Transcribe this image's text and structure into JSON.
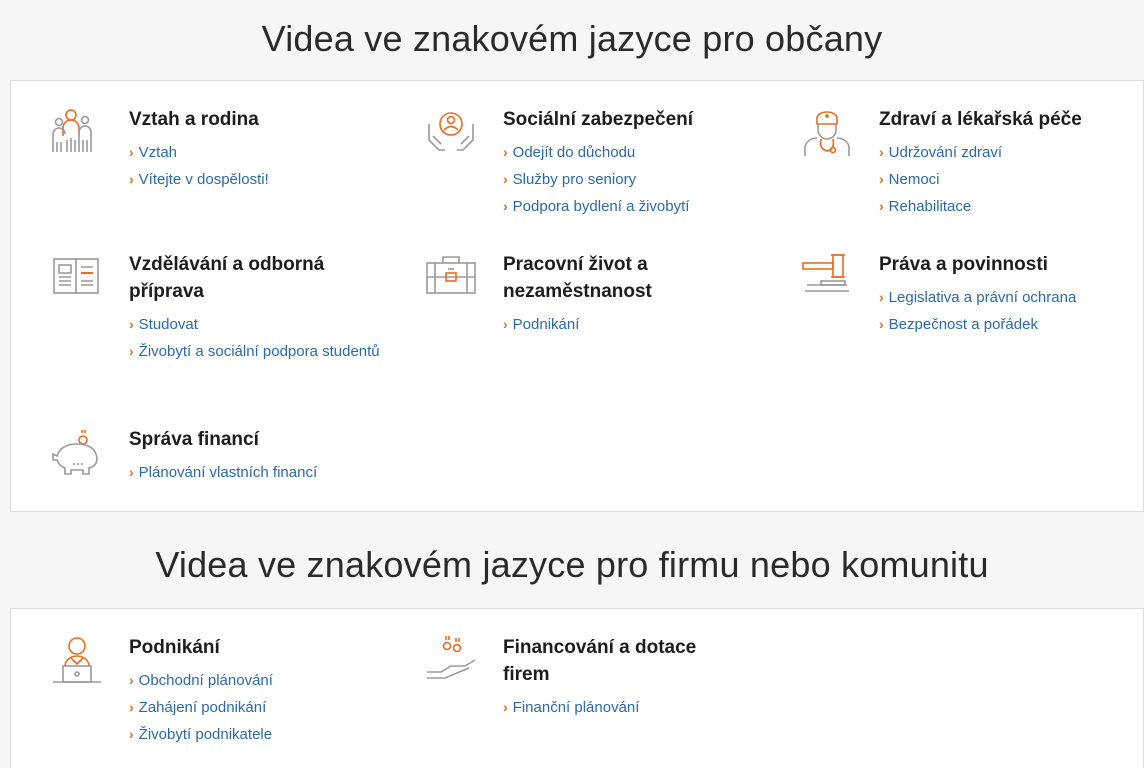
{
  "sections": [
    {
      "title": "Videa ve znakovém jazyce pro občany",
      "categories": [
        {
          "title": "Vztah a rodina",
          "icon": "family-icon",
          "links": [
            "Vztah",
            "Vítejte v dospělosti!"
          ]
        },
        {
          "title": "Sociální zabezpečení",
          "icon": "social-care-icon",
          "links": [
            "Odejít do důchodu",
            "Služby pro seniory",
            "Podpora bydlení a živobytí"
          ]
        },
        {
          "title": "Zdraví a lékařská péče",
          "icon": "doctor-icon",
          "links": [
            "Udržování zdraví",
            "Nemoci",
            "Rehabilitace"
          ]
        },
        {
          "title": "Vzdělávání a odborná příprava",
          "icon": "book-icon",
          "links": [
            "Studovat",
            "Živobytí a sociální podpora studentů"
          ]
        },
        {
          "title": "Pracovní život a nezaměstnanost",
          "icon": "briefcase-icon",
          "links": [
            "Podnikání"
          ]
        },
        {
          "title": "Práva a povinnosti",
          "icon": "gavel-icon",
          "links": [
            "Legislativa a právní ochrana",
            "Bezpečnost a pořádek"
          ]
        },
        {
          "title": "Správa financí",
          "icon": "piggy-bank-icon",
          "links": [
            "Plánování vlastních financí"
          ]
        }
      ]
    },
    {
      "title": "Videa ve znakovém jazyce pro firmu nebo komunitu",
      "categories": [
        {
          "title": "Podnikání",
          "icon": "entrepreneur-icon",
          "links": [
            "Obchodní plánování",
            "Zahájení podnikání",
            "Živobytí podnikatele"
          ]
        },
        {
          "title": "Financování a dotace firem",
          "icon": "funding-hand-icon",
          "links": [
            "Finanční plánování"
          ]
        }
      ]
    }
  ],
  "colors": {
    "link": "#2b6aa8",
    "accent": "#e96b1e",
    "icon_gray": "#9a9a9a"
  }
}
